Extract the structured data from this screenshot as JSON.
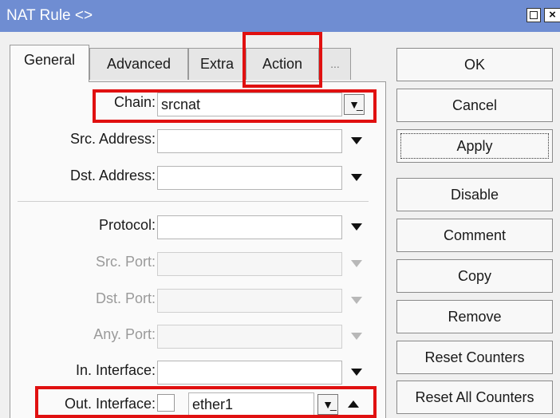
{
  "window": {
    "title": "NAT Rule <>"
  },
  "tabs": [
    {
      "label": "General",
      "active": true
    },
    {
      "label": "Advanced",
      "active": false
    },
    {
      "label": "Extra",
      "active": false
    },
    {
      "label": "Action",
      "active": false
    },
    {
      "label": "...",
      "active": false
    }
  ],
  "fields": {
    "chain": {
      "label": "Chain:",
      "value": "srcnat"
    },
    "src_address": {
      "label": "Src. Address:",
      "value": ""
    },
    "dst_address": {
      "label": "Dst. Address:",
      "value": ""
    },
    "protocol": {
      "label": "Protocol:",
      "value": ""
    },
    "src_port": {
      "label": "Src. Port:",
      "value": ""
    },
    "dst_port": {
      "label": "Dst. Port:",
      "value": ""
    },
    "any_port": {
      "label": "Any. Port:",
      "value": ""
    },
    "in_interface": {
      "label": "In. Interface:",
      "value": ""
    },
    "out_interface": {
      "label": "Out. Interface:",
      "value": "ether1",
      "negate": false
    }
  },
  "buttons": {
    "ok": "OK",
    "cancel": "Cancel",
    "apply": "Apply",
    "disable": "Disable",
    "comment": "Comment",
    "copy": "Copy",
    "remove": "Remove",
    "reset_counters": "Reset Counters",
    "reset_all_counters": "Reset All Counters"
  },
  "colors": {
    "titlebar": "#6f8dd2",
    "highlight": "#e01010"
  }
}
